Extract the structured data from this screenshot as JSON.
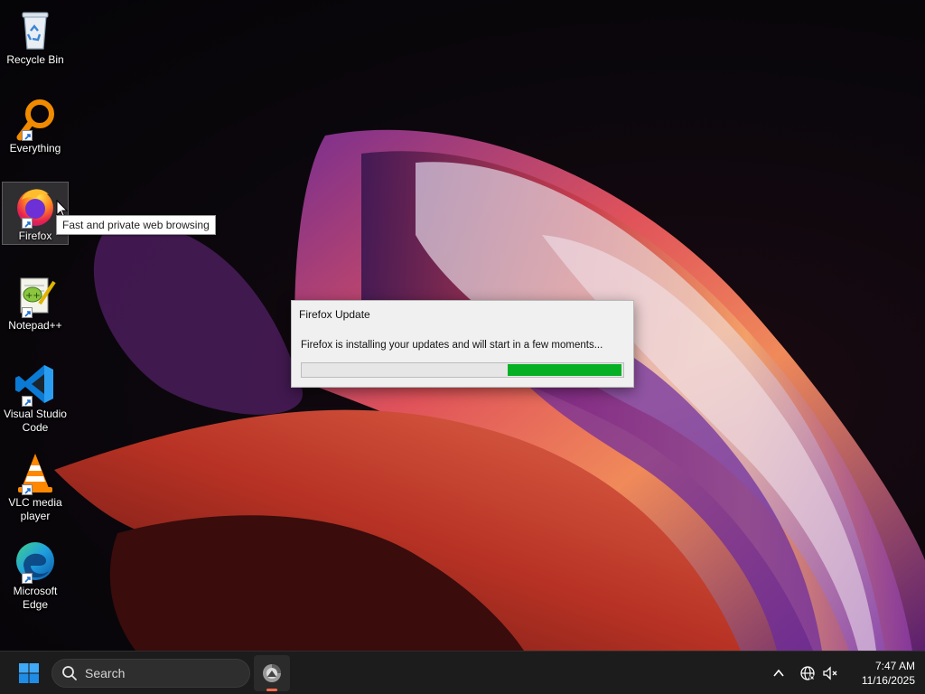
{
  "desktop_icons": [
    {
      "label": "Recycle Bin",
      "icon": "recycle-bin-icon",
      "shortcut": false
    },
    {
      "label": "Everything",
      "icon": "everything-search-icon",
      "shortcut": true
    },
    {
      "label": "Firefox",
      "icon": "firefox-icon",
      "shortcut": true,
      "selected": true
    },
    {
      "label": "Notepad++",
      "icon": "notepad-plus-plus-icon",
      "shortcut": true
    },
    {
      "label": "Visual Studio Code",
      "icon": "vscode-icon",
      "shortcut": true
    },
    {
      "label": "VLC media player",
      "icon": "vlc-icon",
      "shortcut": true
    },
    {
      "label": "Microsoft Edge",
      "icon": "edge-icon",
      "shortcut": true
    }
  ],
  "tooltip": {
    "text": "Fast and private web browsing"
  },
  "dialog": {
    "title": "Firefox Update",
    "message": "Firefox is installing your updates and will start in a few moments...",
    "progress": {
      "style": "indeterminate-marquee",
      "segment_start_fraction": 0.64,
      "segment_end_fraction": 0.995,
      "color": "#06b025"
    }
  },
  "taskbar": {
    "start_icon": "windows-start-icon",
    "search_placeholder": "Search",
    "pinned_apps": [
      {
        "icon": "firefox-updater-icon",
        "active": true,
        "indicator_color": "#ff6a4d"
      }
    ],
    "tray": {
      "chevron_icon": "chevron-up-icon",
      "network_icon": "globe-network-icon",
      "volume_icon": "speaker-muted-icon"
    },
    "clock": {
      "time": "7:47 AM",
      "date": "11/16/2025"
    }
  },
  "colors": {
    "accent": "#0078d4",
    "taskbar": "#1c1c1c",
    "progress": "#06b025"
  }
}
